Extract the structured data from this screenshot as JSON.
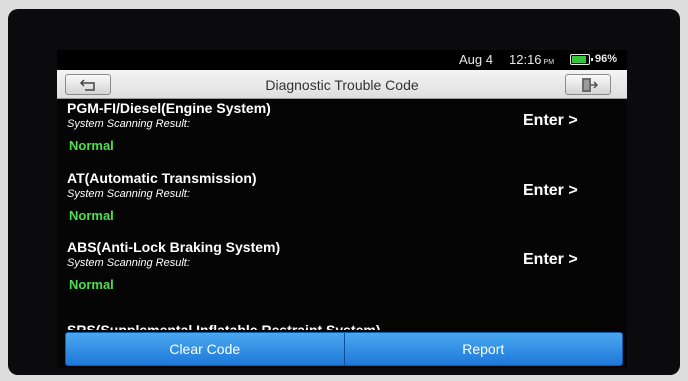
{
  "status_bar": {
    "date": "Aug 4",
    "time": "12:16",
    "ampm": "PM",
    "battery_percent": "96%",
    "battery_level": 0.96,
    "battery_color": "#35c73b"
  },
  "header": {
    "title": "Diagnostic Trouble Code",
    "back_icon": "back-arrow-icon",
    "exit_icon": "exit-door-icon"
  },
  "systems": [
    {
      "name": "PGM-FI/Diesel(Engine System)",
      "sub_label": "System Scanning Result:",
      "status": "Normal",
      "action": "Enter >"
    },
    {
      "name": "AT(Automatic Transmission)",
      "sub_label": "System Scanning Result:",
      "status": "Normal",
      "action": "Enter >"
    },
    {
      "name": "ABS(Anti-Lock Braking System)",
      "sub_label": "System Scanning Result:",
      "status": "Normal",
      "action": "Enter >"
    }
  ],
  "partial_system": {
    "name": "SRS(Supplemental Inflatable Restraint System)"
  },
  "footer": {
    "clear_label": "Clear Code",
    "report_label": "Report"
  },
  "colors": {
    "status_ok": "#4ede4e",
    "button_blue": "#1e78d8"
  }
}
